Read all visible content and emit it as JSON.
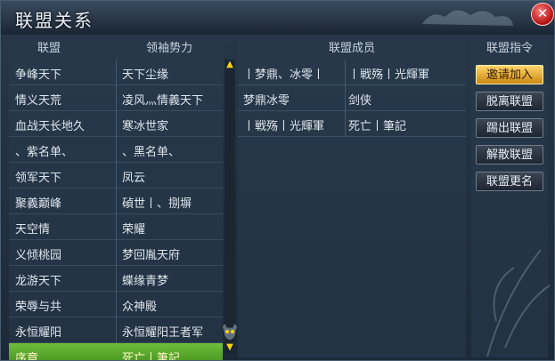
{
  "title": "联盟关系",
  "headers": {
    "alliance": "联盟",
    "leader": "领袖势力",
    "members": "联盟成员",
    "commands": "联盟指令"
  },
  "alliances": [
    {
      "name": "争峰天下",
      "leader": "天下尘缘"
    },
    {
      "name": "情义天荒",
      "leader": "凌风灬情義天下"
    },
    {
      "name": "血战天长地久",
      "leader": "寒冰世家"
    },
    {
      "name": "、紫名单、",
      "leader": "、黑名单、"
    },
    {
      "name": "领军天下",
      "leader": "凤云"
    },
    {
      "name": "聚義巅峰",
      "leader": "碵世丨、捌塀"
    },
    {
      "name": "天空情",
      "leader": "荣耀"
    },
    {
      "name": "义倾桃园",
      "leader": "梦回胤天府"
    },
    {
      "name": "龙游天下",
      "leader": "蝶缘青梦"
    },
    {
      "name": "荣辱与共",
      "leader": "众神殿"
    },
    {
      "name": "永恒耀阳",
      "leader": "永恒耀阳王者军"
    },
    {
      "name": "序章",
      "leader": "死亡丨筆記"
    }
  ],
  "members": [
    {
      "a": "丨梦鼎、冰零丨",
      "b": "丨戦殇丨光輝軍"
    },
    {
      "a": "梦鼎冰零",
      "b": "剑侠"
    },
    {
      "a": "丨戦殇丨光輝軍",
      "b": "死亡丨筆記"
    }
  ],
  "buttons": {
    "invite": "邀请加入",
    "leave": "脱离联盟",
    "kick": "踢出联盟",
    "dissolve": "解散联盟",
    "rename": "联盟更名"
  },
  "icons": {
    "close": "close-icon",
    "scroll_up": "arrow-up-icon",
    "scroll_down": "arrow-down-icon",
    "mascot": "skull-mascot-icon"
  },
  "colors": {
    "selected_row": "#58a42a",
    "primary_button": "#e6a82c",
    "close": "#c81818",
    "scroll_arrow": "#ffd400"
  }
}
